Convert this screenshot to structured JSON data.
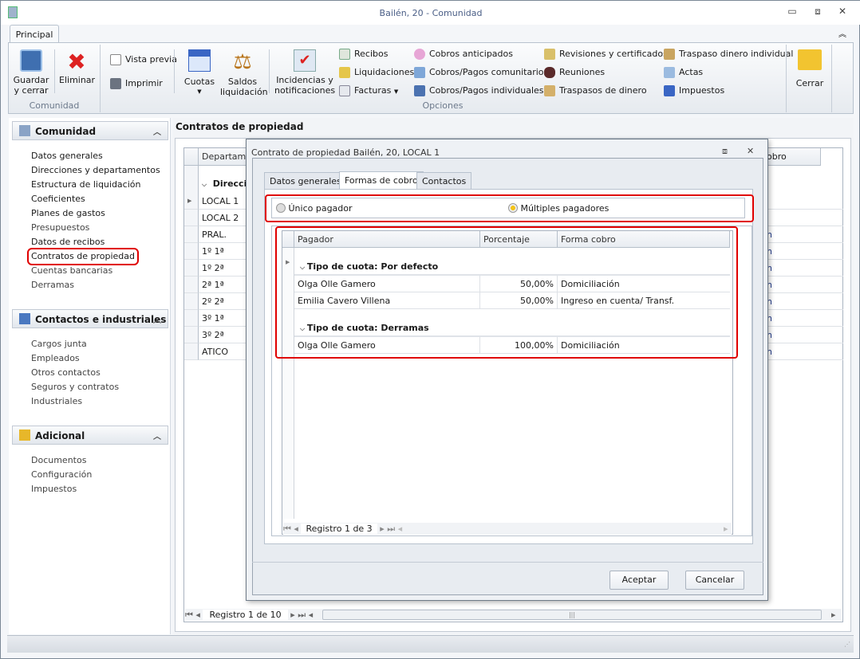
{
  "window": {
    "title": "Bailén, 20 - Comunidad",
    "minimize": "▭",
    "restore": "⧈",
    "close": "✕",
    "collapse_ribbon": "︽"
  },
  "ribbon": {
    "tab": "Principal",
    "groups": {
      "comunidad": "Comunidad",
      "opciones": "Opciones"
    },
    "guardar": "Guardar\ny cerrar",
    "guardar_l1": "Guardar",
    "guardar_l2": "y cerrar",
    "eliminar": "Eliminar",
    "vista_previa": "Vista previa",
    "imprimir": "Imprimir",
    "cuotas": "Cuotas",
    "saldos_l1": "Saldos",
    "saldos_l2": "liquidación",
    "incidencias_l1": "Incidencias y",
    "incidencias_l2": "notificaciones",
    "col1": [
      "Recibos",
      "Liquidaciones",
      "Facturas"
    ],
    "col2": [
      "Cobros anticipados",
      "Cobros/Pagos comunitarios",
      "Cobros/Pagos individuales"
    ],
    "col3": [
      "Revisiones y certificados",
      "Reuniones",
      "Traspasos de dinero"
    ],
    "col4": [
      "Traspaso dinero individual",
      "Actas",
      "Impuestos"
    ],
    "cerrar": "Cerrar"
  },
  "sidebar": {
    "groups": [
      {
        "title": "Comunidad",
        "items": [
          "Datos generales",
          "Direcciones y departamentos",
          "Estructura de liquidación",
          "Coeficientes",
          "Planes de gastos",
          "Presupuestos",
          "Datos de recibos",
          "Contratos de propiedad",
          "Cuentas bancarias",
          "Derramas"
        ]
      },
      {
        "title": "Contactos e industriales",
        "items": [
          "Cargos junta",
          "Empleados",
          "Otros contactos",
          "Seguros y contratos",
          "Industriales"
        ]
      },
      {
        "title": "Adicional",
        "items": [
          "Documentos",
          "Configuración",
          "Impuestos"
        ]
      }
    ],
    "selected": "Contratos de propiedad"
  },
  "main": {
    "title": "Contratos de propiedad",
    "col_departamento": "Departamen",
    "col_cobro": "obro",
    "group": "Direcci",
    "rows": [
      "LOCAL 1",
      "LOCAL 2",
      "PRAL.",
      "1º 1ª",
      "1º 2ª",
      "2ª 1ª",
      "2º 2ª",
      "3º 1ª",
      "3º 2ª",
      "ATICO"
    ],
    "row_tail": "n",
    "pager": "Registro 1 de 10"
  },
  "dialog": {
    "title": "Contrato de propiedad Bailén, 20, LOCAL 1",
    "tabs": [
      "Datos generales",
      "Formas de cobro",
      "Contactos"
    ],
    "active_tab": "Formas de cobro",
    "radio_unico": "Único pagador",
    "radio_multiples": "Múltiples pagadores",
    "selected_radio": "Múltiples pagadores",
    "columns": [
      "Pagador",
      "Porcentaje",
      "Forma cobro"
    ],
    "groups": [
      {
        "label": "Tipo de cuota: Por defecto",
        "rows": [
          {
            "pagador": "Olga Olle Gamero",
            "porcentaje": "50,00%",
            "forma": "Domiciliación"
          },
          {
            "pagador": "Emilia Cavero Villena",
            "porcentaje": "50,00%",
            "forma": "Ingreso en cuenta/ Transf."
          }
        ]
      },
      {
        "label": "Tipo de cuota: Derramas",
        "rows": [
          {
            "pagador": "Olga Olle Gamero",
            "porcentaje": "100,00%",
            "forma": "Domiciliación"
          }
        ]
      }
    ],
    "pager": "Registro 1 de 3",
    "aceptar": "Aceptar",
    "cancelar": "Cancelar"
  },
  "colors": {
    "highlight": "#e00000",
    "accent": "#4a5e86"
  }
}
